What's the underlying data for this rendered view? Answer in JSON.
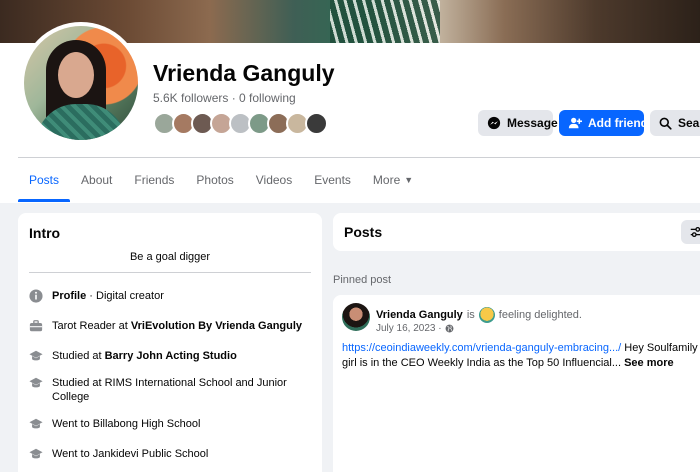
{
  "profile": {
    "name": "Vrienda Ganguly",
    "follow_stats": "5.6K followers · 0 following"
  },
  "actions": {
    "message_label": "Message",
    "add_friend_label": "Add friend",
    "search_label": "Search"
  },
  "tabs": [
    {
      "label": "Posts",
      "active": true
    },
    {
      "label": "About"
    },
    {
      "label": "Friends"
    },
    {
      "label": "Photos"
    },
    {
      "label": "Videos"
    },
    {
      "label": "Events"
    },
    {
      "label": "More"
    }
  ],
  "intro": {
    "title": "Intro",
    "bio": "Be a goal digger",
    "items": [
      {
        "icon": "info-icon",
        "bold": "Profile",
        "text": " · Digital creator"
      },
      {
        "icon": "briefcase-icon",
        "text": "Tarot Reader at ",
        "bold": "VriEvolution By Vrienda Ganguly"
      },
      {
        "icon": "graduation-cap-icon",
        "text": "Studied at ",
        "bold": "Barry John Acting Studio"
      },
      {
        "icon": "graduation-cap-icon",
        "text": "Studied at RIMS International School and Junior College"
      },
      {
        "icon": "graduation-cap-icon",
        "text": "Went to Billabong High School"
      },
      {
        "icon": "graduation-cap-icon",
        "text": "Went to Jankidevi Public School"
      }
    ]
  },
  "posts_section": {
    "title": "Posts",
    "pinned_label": "Pinned post"
  },
  "post": {
    "author": "Vrienda Ganguly",
    "is_text": "is",
    "feeling": "feeling delighted.",
    "date": "July 16, 2023 ·",
    "link": "https://ceoindiaweekly.com/vrienda-ganguly-embracing.../",
    "text_after_link": " Hey Soulfamily",
    "text_line2": "girl is in the CEO Weekly India as the Top 50 Influencial... ",
    "see_more": "See more"
  },
  "colors": {
    "accent": "#0866ff",
    "page_bg": "#f0f2f5",
    "muted_text": "#65676b"
  }
}
